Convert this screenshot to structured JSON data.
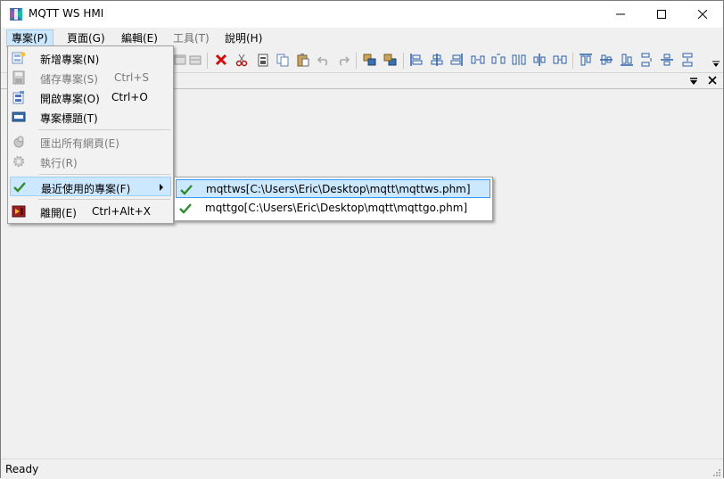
{
  "window": {
    "title": "MQTT WS HMI"
  },
  "menubar": {
    "items": [
      {
        "label": "專案(P)"
      },
      {
        "label": "頁面(G)"
      },
      {
        "label": "編輯(E)"
      },
      {
        "label": "工具(T)"
      },
      {
        "label": "說明(H)"
      }
    ]
  },
  "project_menu": {
    "items": [
      {
        "label": "新增專案(N)",
        "shortcut": ""
      },
      {
        "label": "儲存專案(S)",
        "shortcut": "Ctrl+S"
      },
      {
        "label": "開啟專案(O)",
        "shortcut": "Ctrl+O"
      },
      {
        "label": "專案標題(T)",
        "shortcut": ""
      },
      {
        "label": "匯出所有網頁(E)",
        "shortcut": ""
      },
      {
        "label": "執行(R)",
        "shortcut": ""
      },
      {
        "label": "最近使用的專案(F)",
        "shortcut": ""
      },
      {
        "label": "離開(E)",
        "shortcut": "Ctrl+Alt+X"
      }
    ]
  },
  "recent_menu": {
    "items": [
      {
        "label": "mqttws[C:\\Users\\Eric\\Desktop\\mqtt\\mqttws.phm]"
      },
      {
        "label": "mqttgo[C:\\Users\\Eric\\Desktop\\mqtt\\mqttgo.phm]"
      }
    ]
  },
  "status": {
    "text": "Ready"
  },
  "colors": {
    "highlight": "#cce8ff",
    "highlight_border": "#99d1ff",
    "check_green": "#2e8b2e",
    "delete_red": "#d01010"
  }
}
